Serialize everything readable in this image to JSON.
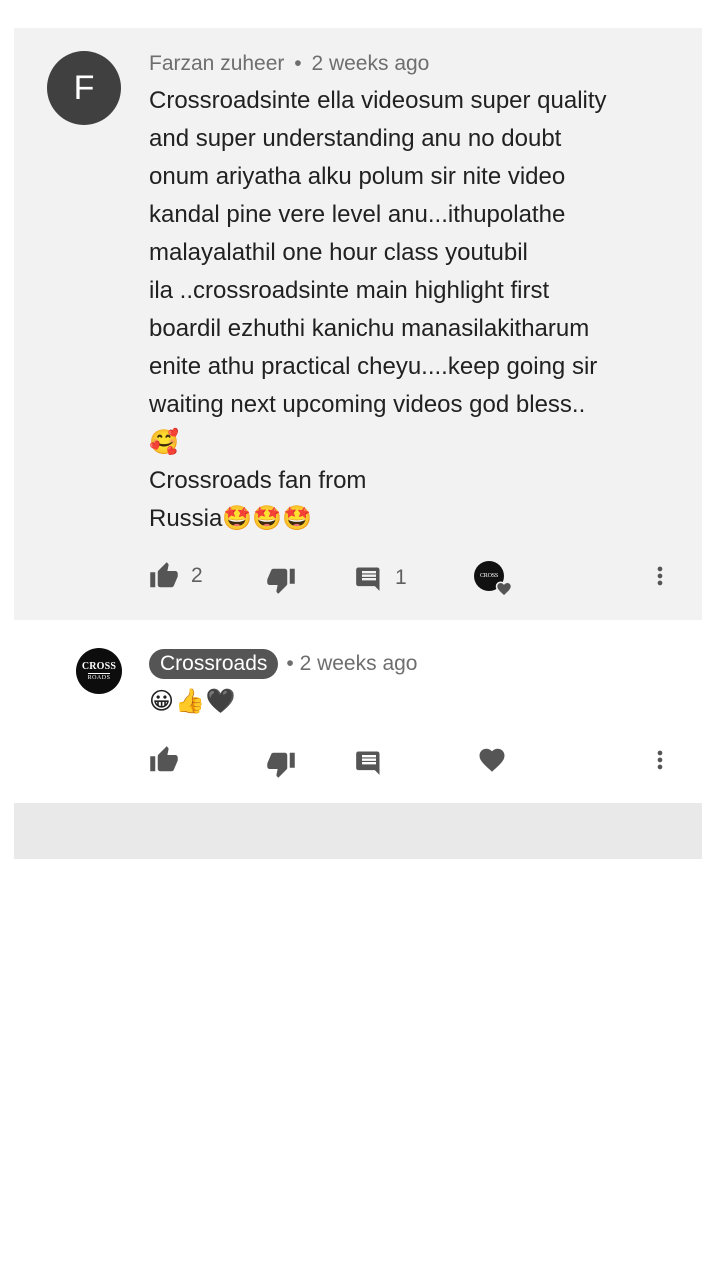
{
  "comment": {
    "avatar_letter": "F",
    "author": "Farzan zuheer",
    "separator": "•",
    "time": "2 weeks ago",
    "text_lines": [
      "Crossroadsinte ella videosum super quality",
      "and super understanding anu no doubt",
      "onum ariyatha alku polum sir nite video",
      "kandal pine vere level anu...ithupolathe",
      "malayalathil one hour class youtubil",
      "ila ..crossroadsinte main highlight first",
      "boardil ezhuthi kanichu manasilakitharum",
      "enite athu practical cheyu....keep going sir",
      "waiting next upcoming videos god bless..",
      "🥰",
      "Crossroads fan from",
      "Russia🤩🤩🤩"
    ],
    "like_count": "2",
    "reply_count": "1",
    "hearted_by_logo_text": "CROSS"
  },
  "reply": {
    "avatar_line1": "CROSS",
    "avatar_line2": "ROADS",
    "author": "Crossroads",
    "separator": "•",
    "time": "2 weeks ago",
    "text": "😀👍🖤"
  },
  "icons": {
    "like": "thumb-up-icon",
    "dislike": "thumb-down-icon",
    "reply": "comment-icon",
    "heart": "heart-icon",
    "more": "more-vert-icon"
  },
  "colors": {
    "card_background": "#f2f2f2",
    "icon": "#555555",
    "author_chip": "#555555",
    "bottom_strip": "#e9e9e9"
  }
}
